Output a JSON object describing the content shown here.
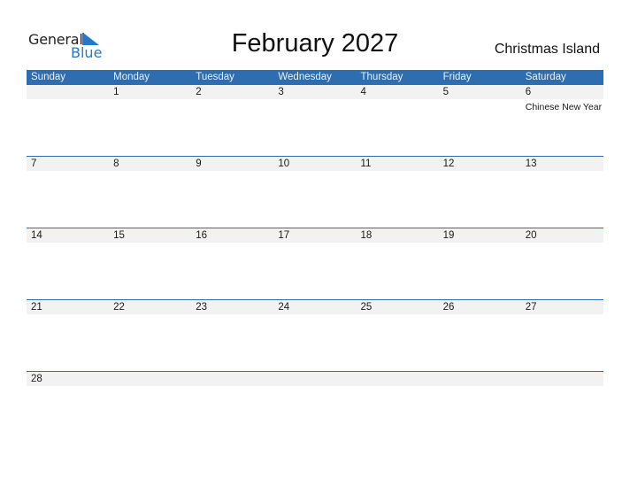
{
  "logo": {
    "word1": "General",
    "word2": "Blue"
  },
  "header": {
    "title": "February 2027",
    "country": "Christmas Island"
  },
  "colors": {
    "accent": "#2e6eb0",
    "band": "#f2f2f2",
    "logo_blue": "#2878c8"
  },
  "weekdays": [
    "Sunday",
    "Monday",
    "Tuesday",
    "Wednesday",
    "Thursday",
    "Friday",
    "Saturday"
  ],
  "weeks": [
    [
      {
        "day": "",
        "event": ""
      },
      {
        "day": "1",
        "event": ""
      },
      {
        "day": "2",
        "event": ""
      },
      {
        "day": "3",
        "event": ""
      },
      {
        "day": "4",
        "event": ""
      },
      {
        "day": "5",
        "event": ""
      },
      {
        "day": "6",
        "event": "Chinese New Year"
      }
    ],
    [
      {
        "day": "7",
        "event": ""
      },
      {
        "day": "8",
        "event": ""
      },
      {
        "day": "9",
        "event": ""
      },
      {
        "day": "10",
        "event": ""
      },
      {
        "day": "11",
        "event": ""
      },
      {
        "day": "12",
        "event": ""
      },
      {
        "day": "13",
        "event": ""
      }
    ],
    [
      {
        "day": "14",
        "event": ""
      },
      {
        "day": "15",
        "event": ""
      },
      {
        "day": "16",
        "event": ""
      },
      {
        "day": "17",
        "event": ""
      },
      {
        "day": "18",
        "event": ""
      },
      {
        "day": "19",
        "event": ""
      },
      {
        "day": "20",
        "event": ""
      }
    ],
    [
      {
        "day": "21",
        "event": ""
      },
      {
        "day": "22",
        "event": ""
      },
      {
        "day": "23",
        "event": ""
      },
      {
        "day": "24",
        "event": ""
      },
      {
        "day": "25",
        "event": ""
      },
      {
        "day": "26",
        "event": ""
      },
      {
        "day": "27",
        "event": ""
      }
    ],
    [
      {
        "day": "28",
        "event": ""
      },
      {
        "day": "",
        "event": ""
      },
      {
        "day": "",
        "event": ""
      },
      {
        "day": "",
        "event": ""
      },
      {
        "day": "",
        "event": ""
      },
      {
        "day": "",
        "event": ""
      },
      {
        "day": "",
        "event": ""
      }
    ]
  ]
}
